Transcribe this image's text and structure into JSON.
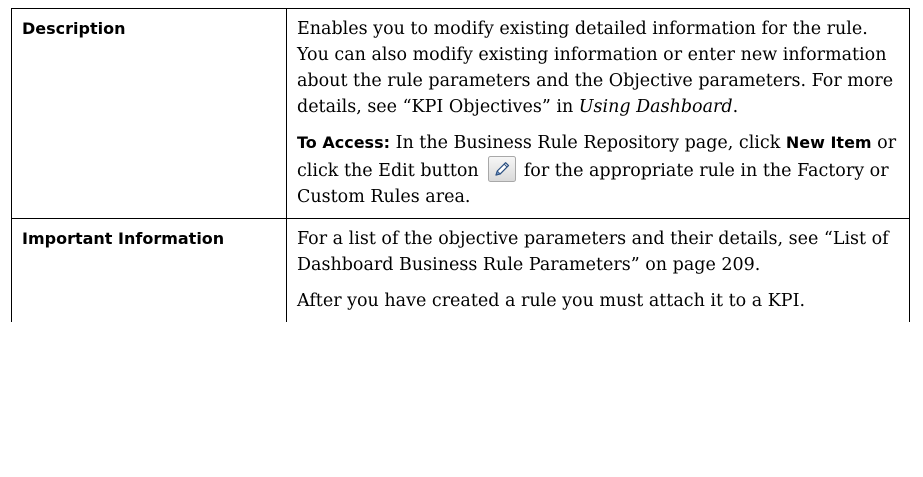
{
  "rows": [
    {
      "label": "Description",
      "paragraphs": {
        "p1": {
          "text": "Enables you to modify existing detailed information for the rule. You can also modify existing information or enter new information about the rule parameters and the Objective parameters. For more details, see “KPI Objectives” in ",
          "ref": "Using Dashboard",
          "tail": "."
        },
        "p2": {
          "lead": "To Access:",
          "text1": " In the Business Rule Repository page, click ",
          "term": "New Item",
          "text2": " or click the Edit button ",
          "icon": "pencil-edit-icon",
          "text3": " for the appropriate rule in the Factory or Custom Rules area."
        }
      }
    },
    {
      "label": "Important Information",
      "paragraphs": {
        "p1": "For a list of the objective parameters and their details, see “List of Dashboard Business Rule Parameters” on page 209.",
        "p2": "After you have created a rule you must attach it to a KPI."
      }
    }
  ]
}
